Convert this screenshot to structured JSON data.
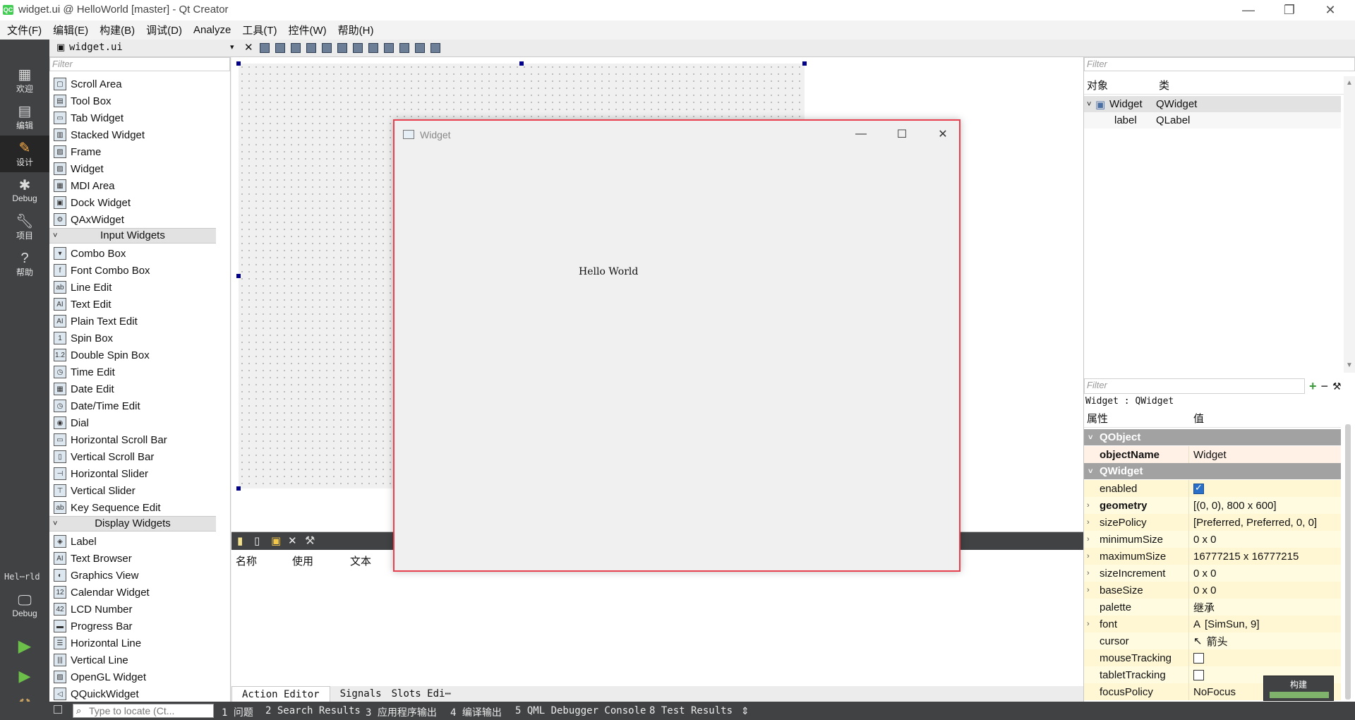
{
  "window": {
    "title": "widget.ui @ HelloWorld [master] - Qt Creator",
    "logo": "QC"
  },
  "menubar": [
    "文件(F)",
    "编辑(E)",
    "构建(B)",
    "调试(D)",
    "Analyze",
    "工具(T)",
    "控件(W)",
    "帮助(H)"
  ],
  "modes": [
    {
      "label": "欢迎",
      "icon": "grid-icon"
    },
    {
      "label": "编辑",
      "icon": "edit-icon"
    },
    {
      "label": "设计",
      "icon": "design-icon"
    },
    {
      "label": "Debug",
      "icon": "bug-icon"
    },
    {
      "label": "项目",
      "icon": "wrench-icon"
    },
    {
      "label": "帮助",
      "icon": "help-icon"
    }
  ],
  "kit": {
    "project": "Hel⋯rld",
    "config": "Debug"
  },
  "editor": {
    "file": "widget.ui"
  },
  "widgetbox": {
    "filter": "Filter",
    "items_top": [
      {
        "label": "Scroll Area",
        "icon": "▢"
      },
      {
        "label": "Tool Box",
        "icon": "▤"
      },
      {
        "label": "Tab Widget",
        "icon": "▭"
      },
      {
        "label": "Stacked Widget",
        "icon": "▥"
      },
      {
        "label": "Frame",
        "icon": "▨"
      },
      {
        "label": "Widget",
        "icon": "▨"
      },
      {
        "label": "MDI Area",
        "icon": "▦"
      },
      {
        "label": "Dock Widget",
        "icon": "▣"
      },
      {
        "label": "QAxWidget",
        "icon": "⚙"
      }
    ],
    "cat_input": "Input Widgets",
    "items_input": [
      {
        "label": "Combo Box",
        "icon": "▾"
      },
      {
        "label": "Font Combo Box",
        "icon": "f"
      },
      {
        "label": "Line Edit",
        "icon": "ab"
      },
      {
        "label": "Text Edit",
        "icon": "AI"
      },
      {
        "label": "Plain Text Edit",
        "icon": "AI"
      },
      {
        "label": "Spin Box",
        "icon": "1"
      },
      {
        "label": "Double Spin Box",
        "icon": "1.2"
      },
      {
        "label": "Time Edit",
        "icon": "◷"
      },
      {
        "label": "Date Edit",
        "icon": "▦"
      },
      {
        "label": "Date/Time Edit",
        "icon": "◷"
      },
      {
        "label": "Dial",
        "icon": "◉"
      },
      {
        "label": "Horizontal Scroll Bar",
        "icon": "▭"
      },
      {
        "label": "Vertical Scroll Bar",
        "icon": "▯"
      },
      {
        "label": "Horizontal Slider",
        "icon": "⊣"
      },
      {
        "label": "Vertical Slider",
        "icon": "⊤"
      },
      {
        "label": "Key Sequence Edit",
        "icon": "ab"
      }
    ],
    "cat_display": "Display Widgets",
    "items_display": [
      {
        "label": "Label",
        "icon": "◈"
      },
      {
        "label": "Text Browser",
        "icon": "AI"
      },
      {
        "label": "Graphics View",
        "icon": "◐"
      },
      {
        "label": "Calendar Widget",
        "icon": "12"
      },
      {
        "label": "LCD Number",
        "icon": "42"
      },
      {
        "label": "Progress Bar",
        "icon": "▬"
      },
      {
        "label": "Horizontal Line",
        "icon": "☰"
      },
      {
        "label": "Vertical Line",
        "icon": "|||"
      },
      {
        "label": "OpenGL Widget",
        "icon": "▨"
      },
      {
        "label": "QQuickWidget",
        "icon": "◁"
      }
    ]
  },
  "action_editor": {
    "columns": [
      "名称",
      "使用",
      "文本"
    ],
    "tabs": [
      "Action Editor",
      "Signals",
      "Slots Edi⋯"
    ]
  },
  "preview": {
    "title": "Widget",
    "label_text": "Hello World"
  },
  "object_inspector": {
    "filter": "Filter",
    "headers": [
      "对象",
      "类"
    ],
    "rows": [
      {
        "object": "Widget",
        "class": "QWidget"
      },
      {
        "object": "label",
        "class": "QLabel"
      }
    ]
  },
  "property_editor": {
    "filter": "Filter",
    "context": "Widget : QWidget",
    "headers": [
      "属性",
      "值"
    ],
    "sections": [
      {
        "name": "QObject",
        "props": [
          {
            "name": "objectName",
            "value": "Widget",
            "bold": true,
            "expand": false
          }
        ]
      },
      {
        "name": "QWidget",
        "props": [
          {
            "name": "enabled",
            "checkbox": true,
            "checked": true
          },
          {
            "name": "geometry",
            "value": "[(0, 0), 800 x 600]",
            "bold": true,
            "expand": true
          },
          {
            "name": "sizePolicy",
            "value": "[Preferred, Preferred, 0, 0]",
            "expand": true
          },
          {
            "name": "minimumSize",
            "value": "0 x 0",
            "expand": true
          },
          {
            "name": "maximumSize",
            "value": "16777215 x 16777215",
            "expand": true
          },
          {
            "name": "sizeIncrement",
            "value": "0 x 0",
            "expand": true
          },
          {
            "name": "baseSize",
            "value": "0 x 0",
            "expand": true
          },
          {
            "name": "palette",
            "value": "继承"
          },
          {
            "name": "font",
            "value": "[SimSun, 9]",
            "icon": "A",
            "expand": true
          },
          {
            "name": "cursor",
            "value": "箭头",
            "icon": "↖"
          },
          {
            "name": "mouseTracking",
            "checkbox": true,
            "checked": false
          },
          {
            "name": "tabletTracking",
            "checkbox": true,
            "checked": false
          },
          {
            "name": "focusPolicy",
            "value": "NoFocus"
          }
        ]
      }
    ]
  },
  "statusbar": {
    "locate_placeholder": "Type to locate (Ct...",
    "panes": [
      "1 问题",
      "2 Search Results",
      "3 应用程序输出",
      "4 编译输出",
      "5 QML Debugger Console",
      "8 Test Results"
    ],
    "arrow": "⇕"
  },
  "build": {
    "label": "构建",
    "progress": 1.0
  },
  "colors": {
    "accent_window_border": "#e8404f",
    "modebar": "#404244",
    "property_bg": "#fffbe0",
    "build_progress": "#7fb26a"
  }
}
